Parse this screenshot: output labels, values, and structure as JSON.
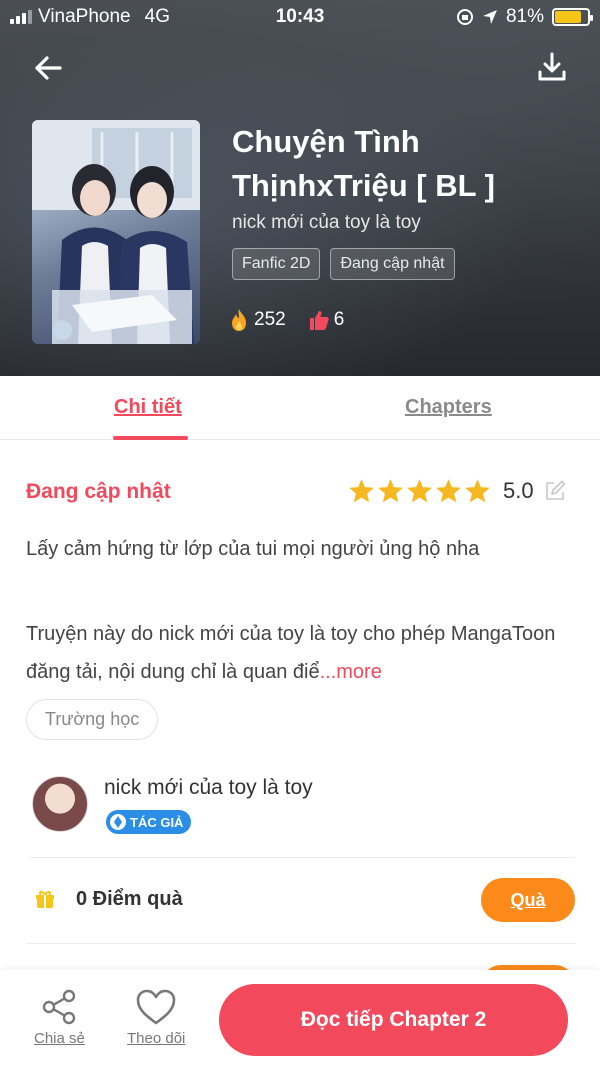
{
  "status_bar": {
    "carrier": "VinaPhone",
    "network": "4G",
    "time": "10:43",
    "battery": "81%",
    "battery_level": 0.81
  },
  "header": {
    "title": "Chuyện Tình ThịnhxTriệu [ BL ]",
    "author": "nick mới của toy là toy",
    "tags": [
      "Fanfic 2D",
      "Đang cập nhật"
    ],
    "views": "252",
    "likes": "6",
    "icons": {
      "back": "arrow-left-icon",
      "download": "download-icon",
      "views": "fire-icon",
      "likes": "thumbs-up-icon"
    }
  },
  "tabs": {
    "detail": "Chi tiết",
    "chapters": "Chapters",
    "active": "detail"
  },
  "detail": {
    "status": "Đang cập nhật",
    "rating": "5.0",
    "stars": 5,
    "description_1": "Lấy cảm hứng từ lớp của tui mọi người ủng hộ nha",
    "description_2": "Truyện này do nick mới của toy là toy cho phép MangaToon đăng tải, nội dung chỉ là quan điể",
    "more": "...more",
    "chip": "Trường học"
  },
  "author_section": {
    "name": "nick mới của toy là toy",
    "badge": "TÁC GIẢ"
  },
  "gift": {
    "text": "0 Điểm quà",
    "button": "Quà"
  },
  "bottom_bar": {
    "share": "Chia sẻ",
    "follow": "Theo dõi",
    "cta": "Đọc tiếp Chapter 2"
  },
  "colors": {
    "accent": "#f2495c",
    "orange": "#fb8a1b",
    "star": "#f5b820",
    "badge": "#2a8de6"
  }
}
